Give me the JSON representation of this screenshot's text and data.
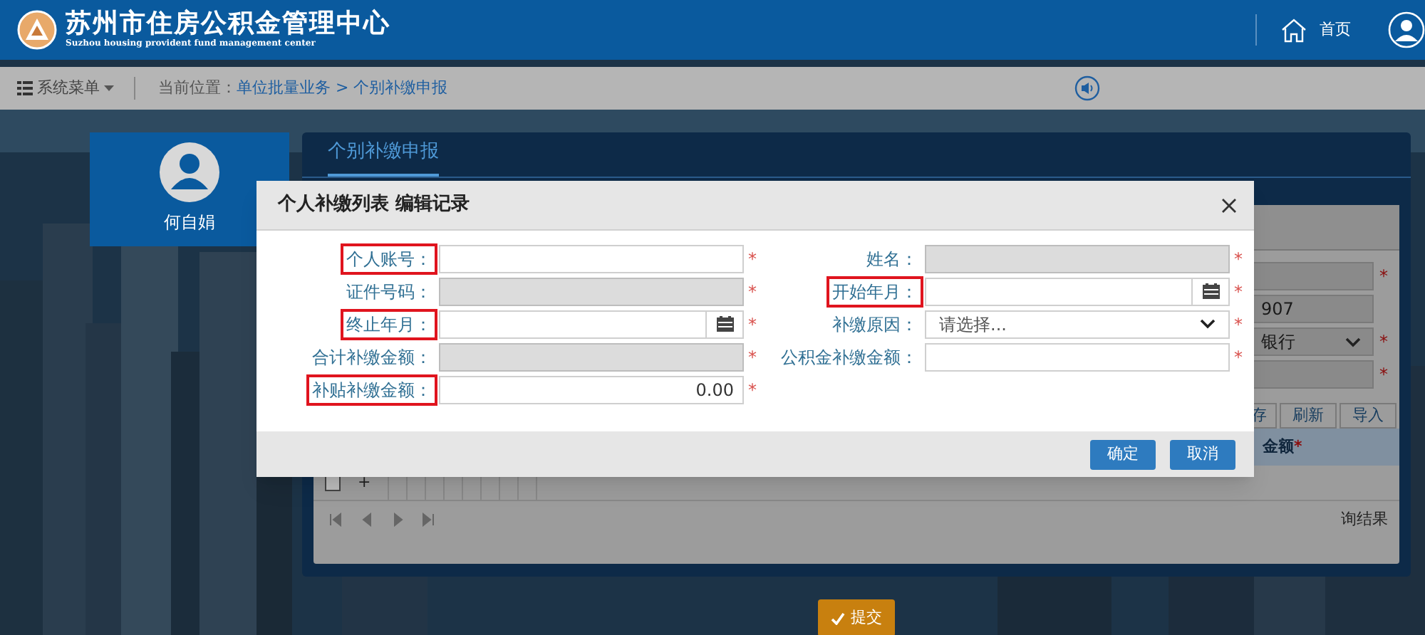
{
  "required_mark": "*",
  "header": {
    "title": "苏州市住房公积金管理中心",
    "subtitle": "Suzhou housing provident fund management center",
    "home": "首页"
  },
  "navbar": {
    "menu": "系统菜单",
    "location_label": "当前位置：",
    "breadcrumb": "单位批量业务 > 个别补缴申报"
  },
  "user": {
    "name": "何自娟"
  },
  "page": {
    "tab": {
      "label": "个别补缴申报",
      "selected": true
    },
    "fields": [
      {
        "kind": "text",
        "mark": "*"
      },
      {
        "kind": "text",
        "value": "907"
      },
      {
        "kind": "select",
        "value": "银行",
        "mark": "*"
      },
      {
        "kind": "text",
        "mark": "*"
      }
    ],
    "toolbar": [
      "存",
      "刷新",
      "导入"
    ],
    "table_header": {
      "label": "金额",
      "required": true
    },
    "row_add": "+",
    "row_checked": false,
    "pager_text": "询结果",
    "submit": "提交"
  },
  "dialog": {
    "title": "个人补缴列表 编辑记录",
    "columns": [
      [
        {
          "label": "个人账号：",
          "kind": "text",
          "disabled": false,
          "highlighted": true,
          "required": true
        },
        {
          "label": "证件号码：",
          "kind": "text",
          "disabled": true,
          "highlighted": false,
          "required": true
        },
        {
          "label": "终止年月：",
          "kind": "date",
          "disabled": false,
          "highlighted": true,
          "required": true
        },
        {
          "label": "合计补缴金额：",
          "kind": "text",
          "disabled": true,
          "highlighted": false,
          "required": true
        },
        {
          "label": "补贴补缴金额：",
          "kind": "number",
          "value": "0.00",
          "disabled": false,
          "highlighted": true,
          "required": true
        }
      ],
      [
        {
          "label": "姓名：",
          "kind": "text",
          "disabled": true,
          "highlighted": false,
          "required": true
        },
        {
          "label": "开始年月：",
          "kind": "date",
          "disabled": false,
          "highlighted": true,
          "required": true
        },
        {
          "label": "补缴原因：",
          "kind": "select",
          "placeholder": "请选择...",
          "disabled": false,
          "highlighted": false,
          "required": true
        },
        {
          "label": "公积金补缴金额：",
          "kind": "text",
          "disabled": false,
          "highlighted": false,
          "required": true
        }
      ]
    ],
    "buttons": [
      "确定",
      "取消"
    ]
  }
}
